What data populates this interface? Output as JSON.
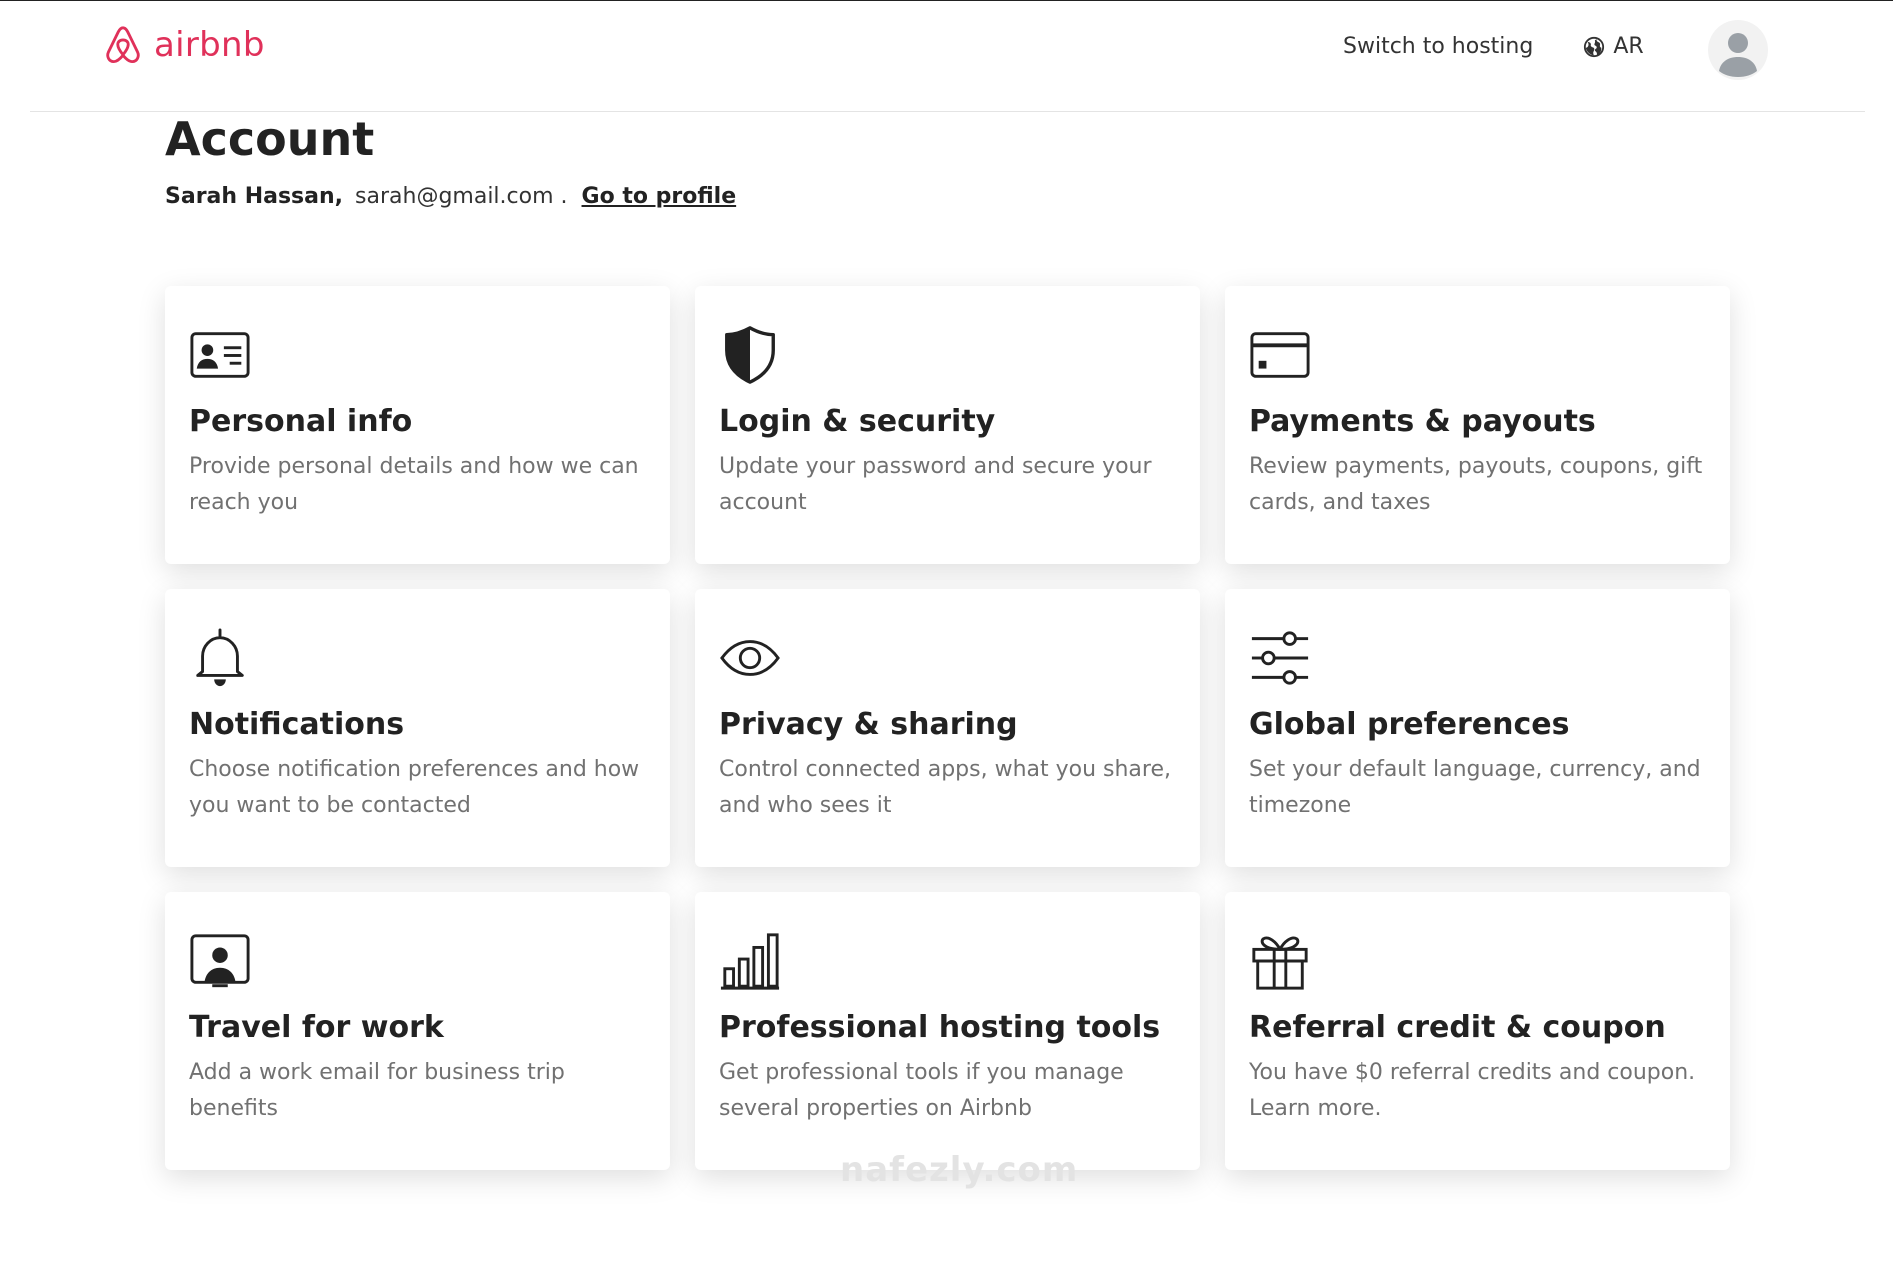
{
  "brand": {
    "name": "airbnb",
    "color": "#e0315a"
  },
  "header": {
    "switch_label": "Switch to hosting",
    "lang_label": "AR",
    "lang_icon": "globe-icon",
    "avatar_icon": "user-avatar-icon"
  },
  "account": {
    "title": "Account",
    "name": "Sarah Hassan,",
    "email": "sarah@gmail.com .",
    "profile_link": "Go to profile"
  },
  "cards": [
    {
      "icon": "id-card-icon",
      "title": "Personal info",
      "desc": "Provide personal details and how we can reach you"
    },
    {
      "icon": "shield-icon",
      "title": "Login & security",
      "desc": "Update your password and secure your account"
    },
    {
      "icon": "credit-card-icon",
      "title": "Payments & payouts",
      "desc": "Review payments, payouts, coupons, gift cards, and taxes"
    },
    {
      "icon": "bell-icon",
      "title": "Notifications",
      "desc": "Choose notification preferences and how you want to be contacted"
    },
    {
      "icon": "eye-icon",
      "title": "Privacy & sharing",
      "desc": "Control connected apps, what you share, and who sees it"
    },
    {
      "icon": "sliders-icon",
      "title": "Global preferences",
      "desc": "Set your default language, currency, and timezone"
    },
    {
      "icon": "presentation-icon",
      "title": "Travel for work",
      "desc": "Add a work email for business trip benefits"
    },
    {
      "icon": "bar-chart-icon",
      "title": "Professional hosting tools",
      "desc": "Get professional tools if you manage several properties on Airbnb"
    },
    {
      "icon": "gift-icon",
      "title": "Referral credit & coupon",
      "desc": "You have $0 referral credits and coupon. Learn more."
    }
  ],
  "watermark": "nafezly.com"
}
